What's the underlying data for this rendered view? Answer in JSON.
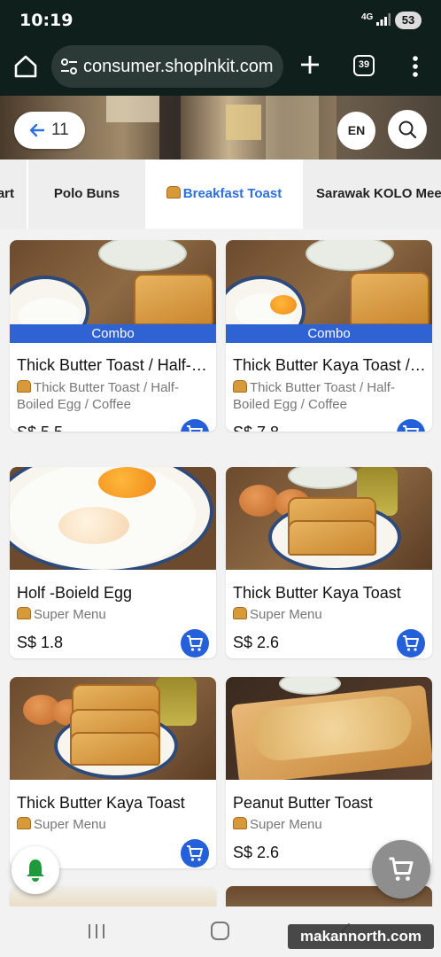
{
  "status_bar": {
    "time": "10:19",
    "network": "4G",
    "battery": "53"
  },
  "browser": {
    "url": "consumer.shoplnkit.com",
    "tab_count": "39"
  },
  "header": {
    "back_count": "11",
    "language": "EN"
  },
  "categories": [
    {
      "label": "art",
      "active": false
    },
    {
      "label": "Polo Buns",
      "active": false
    },
    {
      "label": "Breakfast Toast",
      "active": true
    },
    {
      "label": "Sarawak KOLO Mee",
      "active": false
    }
  ],
  "products": [
    {
      "name": "Thick Butter Toast / Half-Boiled Egg / Coffee",
      "badge": "Combo",
      "description": "Thick Butter Toast / Half-Boiled Egg / Coffee",
      "price": "S$ 5.5"
    },
    {
      "name": "Thick Butter Kaya Toast / Half-Boiled Egg / Coffee",
      "badge": "Combo",
      "description": "Thick Butter Toast / Half-Boiled Egg / Coffee",
      "price": "S$ 7.8"
    },
    {
      "name": "Holf -Boield Egg",
      "description": "Super Menu",
      "price": "S$ 1.8"
    },
    {
      "name": "Thick Butter Kaya Toast",
      "description": "Super Menu",
      "price": "S$ 2.6"
    },
    {
      "name": "Thick Butter Kaya Toast",
      "description": "Super Menu",
      "price": ""
    },
    {
      "name": "Peanut Butter Toast",
      "description": "Super Menu",
      "price": "S$ 2.6"
    }
  ],
  "watermark": "makannorth.com",
  "colors": {
    "accent": "#2d6fe0",
    "cart_button": "#2360d9",
    "badge": "#2f63d4",
    "top_bar": "#0f1f1b"
  },
  "icons": [
    "home-icon",
    "site-settings-icon",
    "new-tab-icon",
    "tabs-icon",
    "menu-icon",
    "back-arrow-icon",
    "search-icon",
    "toast-icon",
    "cart-icon",
    "bell-icon",
    "recents-icon",
    "home-nav-icon",
    "back-nav-icon"
  ]
}
